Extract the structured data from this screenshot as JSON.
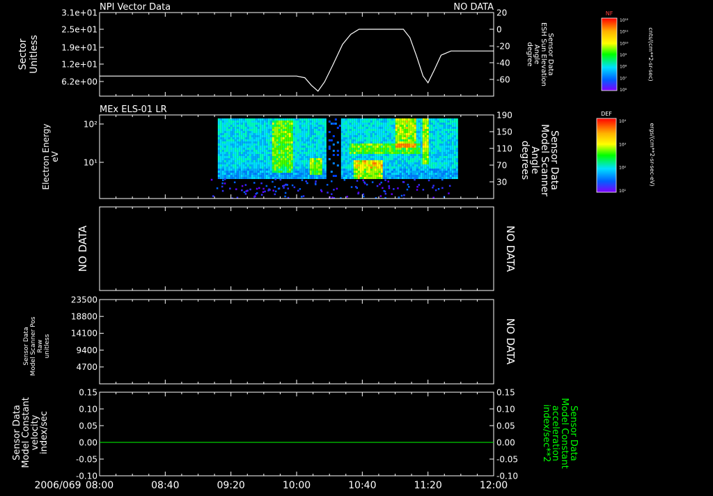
{
  "time_axis": {
    "date_label": "2006/069",
    "tick_labels": [
      "08:00",
      "08:40",
      "09:20",
      "10:00",
      "10:40",
      "11:20",
      "12:00"
    ],
    "range": [
      "08:00",
      "12:00"
    ]
  },
  "colors": {
    "background": "#000000",
    "foreground": "#ffffff",
    "green_trace": "#00ff00"
  },
  "chart_data": [
    {
      "type": "line",
      "title": "NPI Vector Data",
      "status": "NO DATA",
      "left_axis": {
        "label_lines": [
          "Sector",
          "Unitless"
        ],
        "tick_labels": [
          "3.1e+01",
          "2.5e+01",
          "1.9e+01",
          "1.2e+01",
          "6.2e+00"
        ]
      },
      "right_axis": {
        "label_lines": [
          "Sensor Data",
          "ESH Sun Elevation",
          "Angle",
          "degree"
        ],
        "tick_labels": [
          "20",
          "0",
          "-20",
          "-40",
          "-60"
        ],
        "ylim": [
          -80,
          20
        ]
      },
      "colorbar": {
        "label": "NF",
        "units": "cnts/(cm**2-sr-sec)",
        "tick_labels": [
          "10¹²",
          "10¹¹",
          "10¹⁰",
          "10⁹",
          "10⁸",
          "10⁷",
          "10⁶"
        ]
      },
      "series": [
        {
          "axis": "right",
          "x": [
            "08:00",
            "08:40",
            "09:20",
            "09:50",
            "10:00",
            "10:05",
            "10:09",
            "10:13",
            "10:17",
            "10:22",
            "10:28",
            "10:33",
            "10:38",
            "10:44",
            "11:05",
            "11:09",
            "11:13",
            "11:17",
            "11:20",
            "11:24",
            "11:28",
            "11:34",
            "12:00"
          ],
          "values": [
            -56,
            -56,
            -56,
            -56,
            -56,
            -58,
            -67,
            -74,
            -63,
            -43,
            -18,
            -6,
            0,
            0,
            0,
            -10,
            -32,
            -56,
            -64,
            -48,
            -31,
            -26,
            -26
          ]
        }
      ]
    },
    {
      "type": "heatmap",
      "title": "MEx ELS-01 LR",
      "left_axis": {
        "label_lines": [
          "Electron Energy",
          "eV"
        ],
        "tick_labels": [
          "10²",
          "10¹"
        ]
      },
      "right_axis": {
        "label_lines": [
          "Sensor Data",
          "Model Scanner",
          "Angle",
          "degrees"
        ],
        "tick_labels": [
          "190",
          "150",
          "110",
          "70",
          "30"
        ],
        "ylim": [
          -10,
          190
        ]
      },
      "colorbar": {
        "label": "DEF",
        "units": "ergs/(cm**2-sr-sec-eV)",
        "tick_labels": [
          "10⁴",
          "10³",
          "10²",
          "10¹"
        ]
      },
      "data_extent": [
        "09:12",
        "11:38"
      ]
    },
    {
      "type": "line",
      "left_label": "NO DATA",
      "right_label": "NO DATA"
    },
    {
      "type": "line",
      "left_axis": {
        "label_lines": [
          "Sensor Data",
          "Model Scanner Pos",
          "Raw",
          "unitless"
        ],
        "tick_labels": [
          "23500",
          "18800",
          "14100",
          "9400",
          "4700"
        ],
        "ylim": [
          0,
          23500
        ]
      },
      "right_label": "NO DATA"
    },
    {
      "type": "line",
      "left_axis": {
        "label_lines": [
          "Sensor Data",
          "Model Constant",
          "velocity",
          "index/sec"
        ],
        "tick_labels": [
          "0.15",
          "0.10",
          "0.05",
          "0.00",
          "-0.05",
          "-0.10"
        ],
        "ylim": [
          -0.1,
          0.15
        ]
      },
      "right_axis": {
        "label_lines": [
          "Sensor Data",
          "Model Constant",
          "acceleration",
          "index/sec**2"
        ],
        "tick_labels": [
          "0.15",
          "0.10",
          "0.05",
          "0.00",
          "-0.05",
          "-0.10"
        ],
        "ylim": [
          -0.1,
          0.15
        ]
      },
      "series": [
        {
          "axis": "left",
          "x": [
            "08:00",
            "12:00"
          ],
          "values": [
            0,
            0
          ]
        }
      ]
    }
  ]
}
